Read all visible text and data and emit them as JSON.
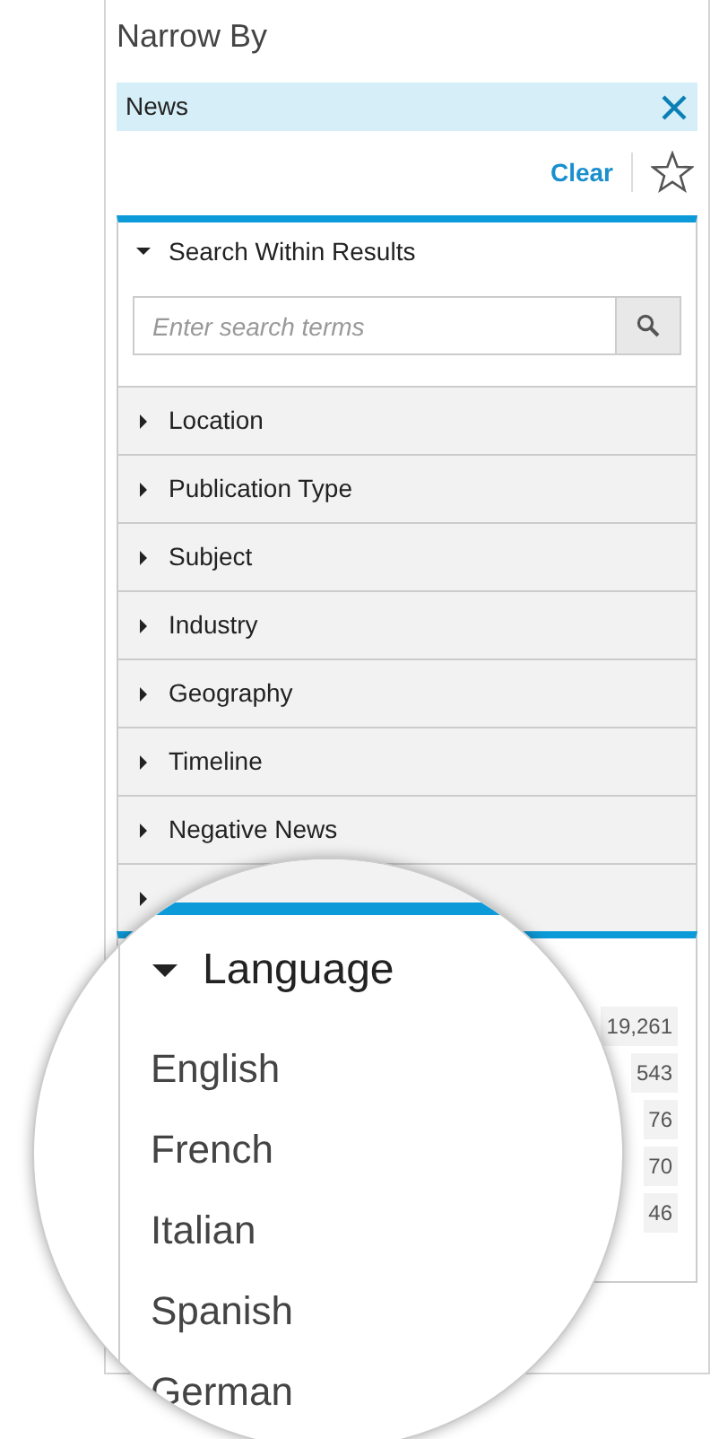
{
  "title": "Narrow By",
  "active_filter": {
    "label": "News"
  },
  "clear_link": "Clear",
  "search_section": {
    "label": "Search Within Results",
    "expanded": true,
    "placeholder": "Enter search terms"
  },
  "facets": [
    {
      "label": "Location",
      "expanded": false
    },
    {
      "label": "Publication Type",
      "expanded": false
    },
    {
      "label": "Subject",
      "expanded": false
    },
    {
      "label": "Industry",
      "expanded": false
    },
    {
      "label": "Geography",
      "expanded": false
    },
    {
      "label": "Timeline",
      "expanded": false
    },
    {
      "label": "Negative News",
      "expanded": false
    },
    {
      "expanded": false
    }
  ],
  "language_section": {
    "label": "Language",
    "expanded": true,
    "items": [
      {
        "label": "English",
        "count": "19,261"
      },
      {
        "label": "French",
        "count": "543"
      },
      {
        "label": "Italian",
        "count": "76"
      },
      {
        "label": "Spanish",
        "count": "70"
      },
      {
        "label": "German",
        "count": "46"
      }
    ]
  }
}
